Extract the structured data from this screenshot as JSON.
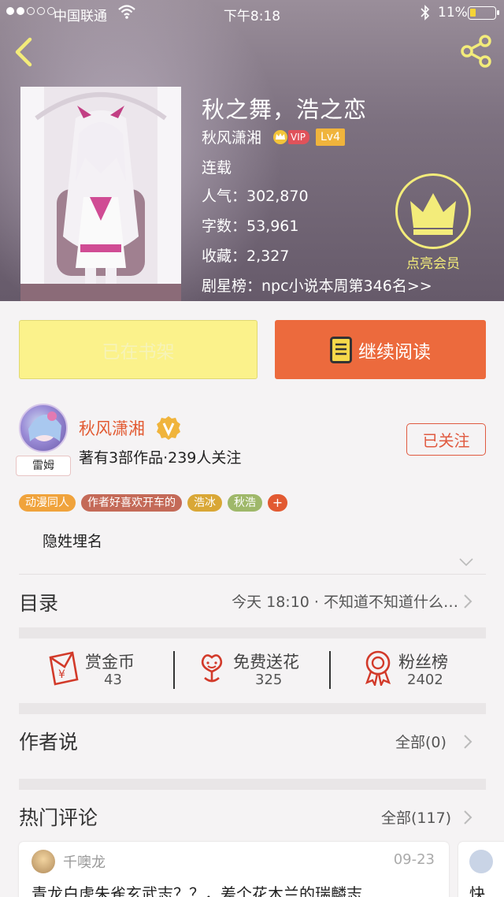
{
  "status_bar": {
    "carrier": "中国联通",
    "time": "下午8:18",
    "battery": "11%"
  },
  "book": {
    "title": "秋之舞，浩之恋",
    "author": "秋风潇湘",
    "vip_label": "VIP",
    "level": "Lv4",
    "status": "连载",
    "popularity": "人气：302,870",
    "word_count": "字数：53,961",
    "favorites": "收藏：2,327",
    "ranking": "剧星榜：npc小说本周第346名>>",
    "member_label": "点亮会员"
  },
  "actions": {
    "shelf_label": "已在书架",
    "read_label": "继续阅读"
  },
  "author_card": {
    "avatar_tag": "雷姆",
    "name": "秋风潇湘",
    "meta": "著有3部作品·239人关注",
    "follow_label": "已关注"
  },
  "tags": [
    {
      "label": "动漫同人",
      "color": "#f0a33c"
    },
    {
      "label": "作者好喜欢开车的",
      "color": "#c46a58"
    },
    {
      "label": "浩冰",
      "color": "#d9a736"
    },
    {
      "label": "秋浩",
      "color": "#9fb86a"
    }
  ],
  "tag_add": "+",
  "intro": "隐姓埋名",
  "toc": {
    "title": "目录",
    "latest": "今天 18:10 · 不知道不知道什么…"
  },
  "stats": [
    {
      "label": "赏金币",
      "value": "43",
      "icon": "envelope-yen-icon"
    },
    {
      "label": "免费送花",
      "value": "325",
      "icon": "flower-icon"
    },
    {
      "label": "粉丝榜",
      "value": "2402",
      "icon": "award-ribbon-icon"
    }
  ],
  "author_says": {
    "title": "作者说",
    "link": "全部(0)"
  },
  "hot_comments": {
    "title": "热门评论",
    "link": "全部(117)",
    "items": [
      {
        "user": "千噢龙",
        "date": "09-23",
        "text": "青龙白虎朱雀玄武志？？，差个花木兰的瑞麟志"
      },
      {
        "user": "",
        "date": "",
        "text": "快"
      }
    ]
  },
  "colors": {
    "accent": "#ec6a3d",
    "shelf_button": "#fbf28b",
    "member_gold": "#f3ec7a"
  }
}
